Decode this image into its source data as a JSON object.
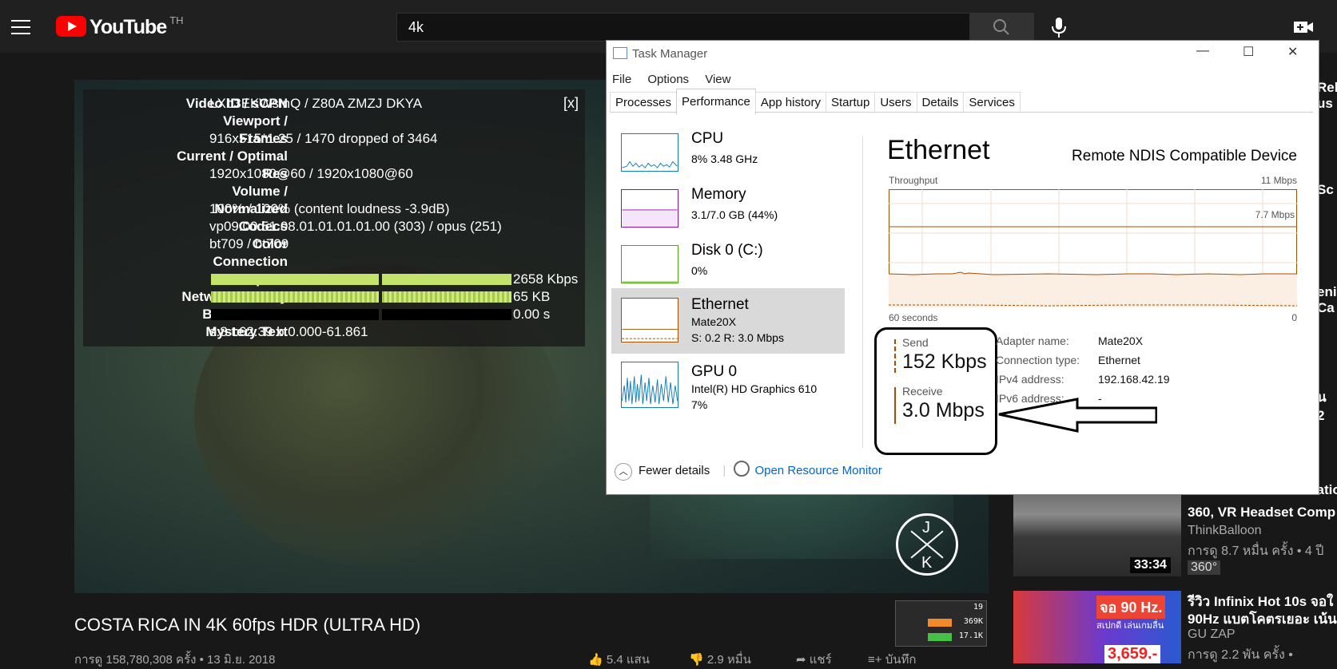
{
  "youtube": {
    "logo_text": "YouTube",
    "country": "TH",
    "search_value": "4k",
    "video_title": "COSTA RICA IN 4K 60fps HDR (ULTRA HD)",
    "video_meta": "การดู 158,780,308 ครั้ง • 13 มิ.ย. 2018",
    "likes": "5.4 แสน",
    "dislikes": "2.9 หมื่น",
    "share": "แชร์",
    "save": "บันทึก"
  },
  "stats_for_nerds": {
    "close": "[x]",
    "rows": [
      {
        "label": "Video ID / sCPN",
        "value": "LXb3EKWsInQ / Z80A ZMZJ DKYA"
      },
      {
        "label": "Viewport /",
        "value": ""
      },
      {
        "label": "Frames",
        "value": "916x515*1.25 / 1470 dropped of 3464"
      },
      {
        "label": "Current / Optimal",
        "value": ""
      },
      {
        "label": "Res",
        "value": "1920x1080@60 / 1920x1080@60"
      },
      {
        "label": "Volume /",
        "value": ""
      },
      {
        "label": "Normalized",
        "value": "100% / 100% (content loudness -3.9dB)"
      },
      {
        "label": "Codecs",
        "value": "vp09.00.51.08.01.01.01.01.00 (303) / opus (251)"
      },
      {
        "label": "Color",
        "value": "bt709 / bt709"
      },
      {
        "label": "Connection",
        "value": ""
      },
      {
        "label": "Speed",
        "value": "2658 Kbps"
      },
      {
        "label": "Network Activity",
        "value": "65 KB"
      },
      {
        "label": "Buffer Health",
        "value": "0.00 s"
      },
      {
        "label": "Mystery Text",
        "value": "s:8 t:62.39 b:0.000-61.861"
      }
    ]
  },
  "mini_monitor": {
    "v1": "19",
    "v2": "369K",
    "v3": "17.1K"
  },
  "recommendations": [
    {
      "title": "Beach Sunset Meditatio",
      "title2": "360, VR Headset Comp",
      "channel": "ThinkBalloon",
      "meta": "การดู 8.7 หมื่น ครั้ง • 4 ปี",
      "badge": "360°",
      "duration": "33:34"
    },
    {
      "title": "รีวิว Infinix Hot 10s จอใ",
      "title2": "90Hz แบตโคตรเยอะ เน้น",
      "channel": "GU ZAP",
      "meta": "การดู 2.2 พัน ครั้ง •",
      "thumb_text": "จอ 90 Hz.",
      "thumb_sub": "สเปกดี เล่นเกมลื่น",
      "price": "3,659.-"
    }
  ],
  "edge_fragments": [
    "Rel",
    "us",
    "Sc",
    "eni",
    "Ca",
    "น 2"
  ],
  "task_manager": {
    "title": "Task Manager",
    "menu": [
      "File",
      "Options",
      "View"
    ],
    "tabs": [
      "Processes",
      "Performance",
      "App history",
      "Startup",
      "Users",
      "Details",
      "Services"
    ],
    "active_tab": "Performance",
    "items": [
      {
        "name": "CPU",
        "sub1": "8%  3.48 GHz",
        "sub2": "",
        "color": "#117dbb"
      },
      {
        "name": "Memory",
        "sub1": "3.1/7.0 GB (44%)",
        "sub2": "",
        "color": "#8b12ae"
      },
      {
        "name": "Disk 0 (C:)",
        "sub1": "0%",
        "sub2": "",
        "color": "#4da60c"
      },
      {
        "name": "Ethernet",
        "sub1": "Mate20X",
        "sub2": "S: 0.2  R: 3.0 Mbps",
        "color": "#a74f01"
      },
      {
        "name": "GPU 0",
        "sub1": "Intel(R) HD Graphics 610",
        "sub2": "7%",
        "color": "#117dbb"
      }
    ],
    "detail_title": "Ethernet",
    "device": "Remote NDIS Compatible Device",
    "throughput_label": "Throughput",
    "throughput_max": "11 Mbps",
    "throughput_mid": "7.7 Mbps",
    "time_label": "60 seconds",
    "time_zero": "0",
    "send_label": "Send",
    "send_value": "152 Kbps",
    "receive_label": "Receive",
    "receive_value": "3.0 Mbps",
    "props": [
      {
        "key": "Adapter name:",
        "value": "Mate20X"
      },
      {
        "key": "Connection type:",
        "value": "Ethernet"
      },
      {
        "key": "IPv4 address:",
        "value": "192.168.42.19"
      },
      {
        "key": "IPv6 address:",
        "value": "-"
      }
    ],
    "fewer_details": "Fewer details",
    "resource_monitor": "Open Resource Monitor"
  }
}
